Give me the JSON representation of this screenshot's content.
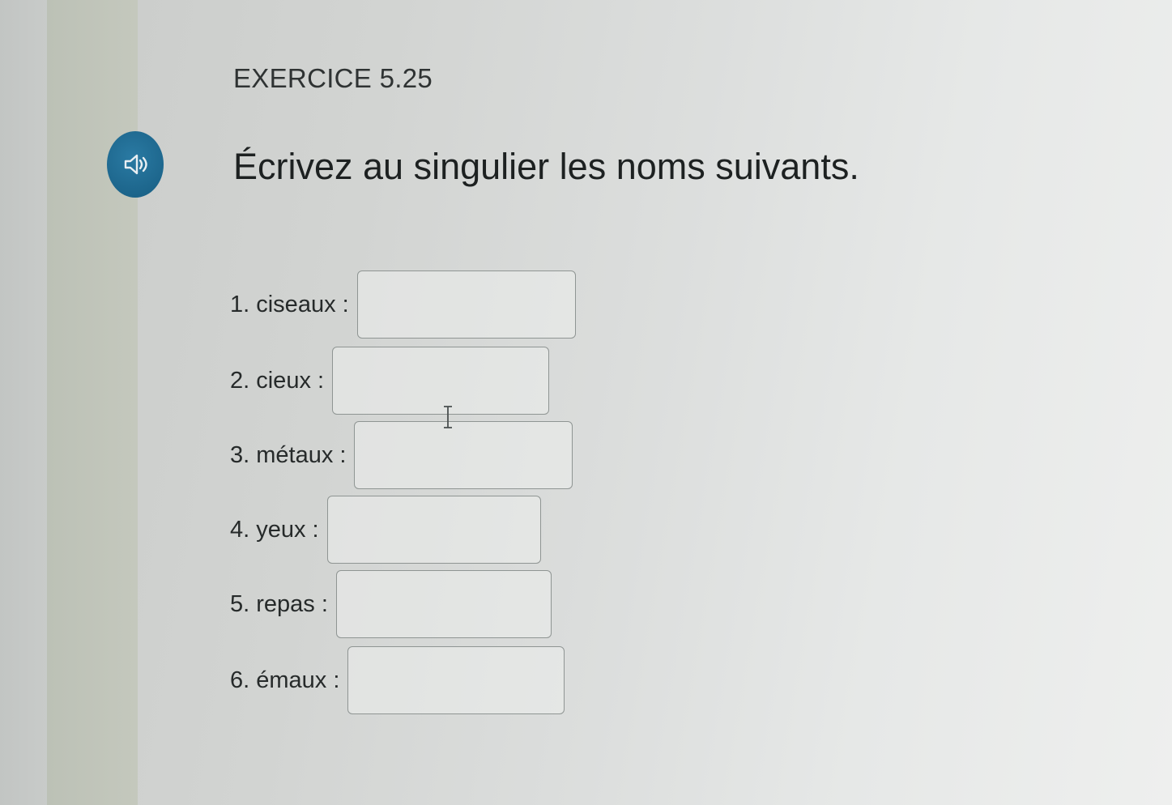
{
  "exercise": {
    "label": "EXERCICE 5.25",
    "instruction": "Écrivez au singulier les noms suivants."
  },
  "audio_button": {
    "icon": "speaker-icon",
    "color": "#1b6389"
  },
  "questions": [
    {
      "label": "1. ciseaux :",
      "value": ""
    },
    {
      "label": "2. cieux :",
      "value": ""
    },
    {
      "label": "3. métaux :",
      "value": ""
    },
    {
      "label": "4. yeux :",
      "value": ""
    },
    {
      "label": "5. repas :",
      "value": ""
    },
    {
      "label": "6. émaux :",
      "value": ""
    }
  ]
}
